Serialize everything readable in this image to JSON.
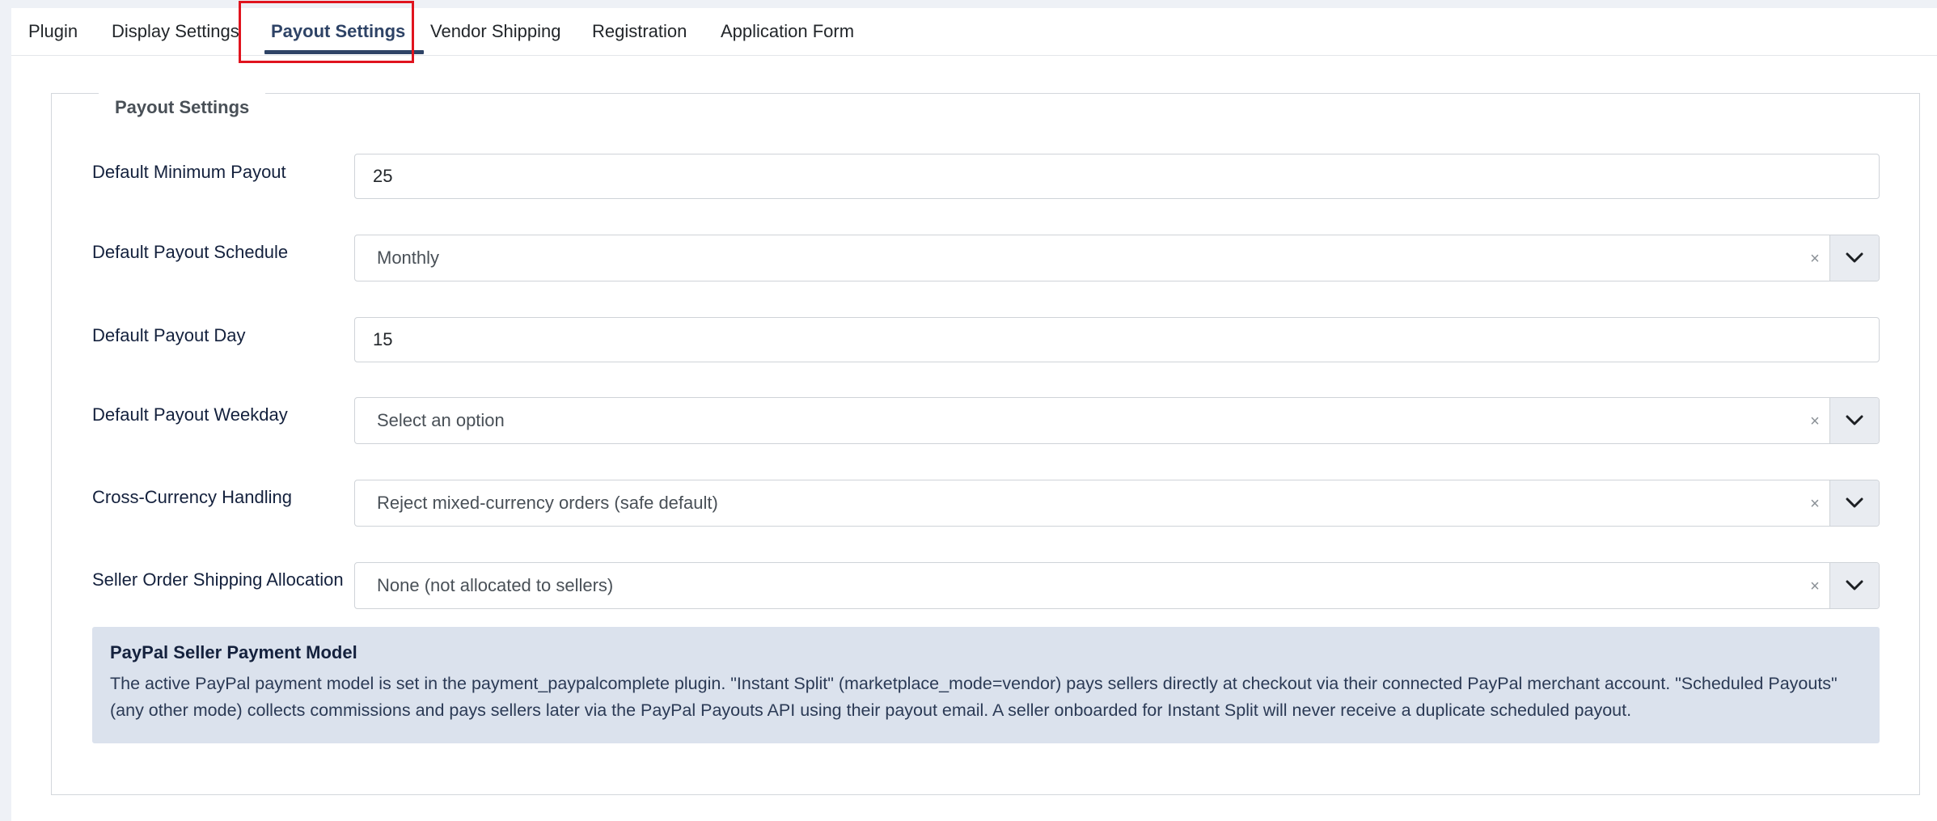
{
  "tabs": {
    "plugin": "Plugin",
    "display_settings": "Display Settings",
    "payout_settings": "Payout Settings",
    "vendor_shipping": "Vendor Shipping",
    "registration": "Registration",
    "application_form": "Application Form",
    "active": "Payout Settings"
  },
  "fieldset": {
    "legend": "Payout Settings"
  },
  "fields": {
    "min_payout": {
      "label": "Default Minimum Payout",
      "value": "25"
    },
    "payout_schedule": {
      "label": "Default Payout Schedule",
      "value": "Monthly"
    },
    "payout_day": {
      "label": "Default Payout Day",
      "value": "15"
    },
    "payout_weekday": {
      "label": "Default Payout Weekday",
      "placeholder": "Select an option"
    },
    "cross_currency": {
      "label": "Cross-Currency Handling",
      "value": "Reject mixed-currency orders (safe default)"
    },
    "shipping_allocation": {
      "label": "Seller Order Shipping Allocation",
      "value": "None (not allocated to sellers)"
    }
  },
  "info": {
    "title": "PayPal Seller Payment Model",
    "body": "The active PayPal payment model is set in the payment_paypalcomplete plugin. \"Instant Split\" (marketplace_mode=vendor) pays sellers directly at checkout via their connected PayPal merchant account. \"Scheduled Payouts\" (any other mode) collects commissions and pays sellers later via the PayPal Payouts API using their payout email. A seller onboarded for Instant Split will never receive a duplicate scheduled payout."
  },
  "icons": {
    "clear": "×",
    "chevron": "chevron-down-icon"
  },
  "colors": {
    "accent": "#2e4366",
    "highlight": "#e0141e",
    "info_bg": "#dbe2ed"
  }
}
